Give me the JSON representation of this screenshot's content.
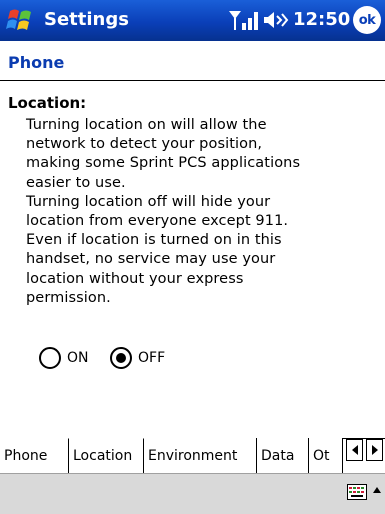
{
  "titlebar": {
    "app_title": "Settings",
    "clock": "12:50",
    "ok_label": "ok",
    "start_icon": "windows-flag-icon",
    "signal_icon": "signal-strength-icon",
    "volume_icon": "speaker-volume-icon"
  },
  "page": {
    "header": "Phone",
    "section_title": "Location:",
    "body_text": "Turning location on will allow the\nnetwork to detect your position,\nmaking some Sprint PCS applications\neasier to use.\nTurning location off will hide your\nlocation from everyone except 911.\nEven if location is turned on in this\nhandset, no service may use your\nlocation without your express\npermission."
  },
  "radio": {
    "on_label": "ON",
    "off_label": "OFF",
    "selected": "OFF"
  },
  "tabs": [
    {
      "label": "Phone",
      "active": false
    },
    {
      "label": "Location",
      "active": true
    },
    {
      "label": "Environment",
      "active": false
    },
    {
      "label": "Data",
      "active": false
    },
    {
      "label": "Ot",
      "active": false
    }
  ],
  "menubar": {
    "keyboard_icon": "keyboard-icon",
    "arrow_icon": "up-arrow-icon"
  },
  "colors": {
    "titlebar_blue": "#0a3fb8",
    "header_blue": "#0b3cb0",
    "menubar_gray": "#d9d9d9"
  }
}
